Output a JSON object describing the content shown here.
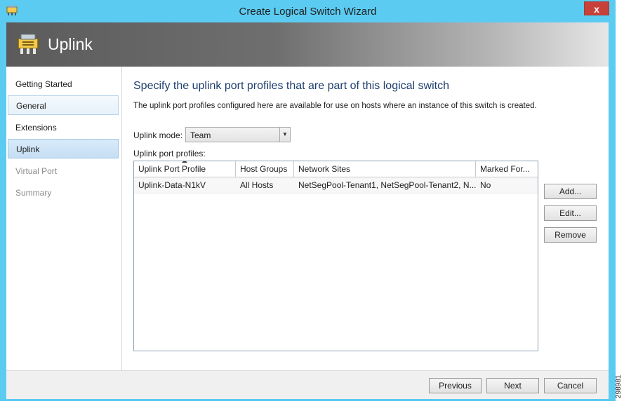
{
  "window": {
    "title": "Create Logical Switch Wizard",
    "close_label": "x",
    "icon": "logical-switch-icon"
  },
  "banner": {
    "title": "Uplink",
    "icon": "logical-switch-icon"
  },
  "nav": {
    "items": [
      {
        "label": "Getting Started",
        "state": "normal"
      },
      {
        "label": "General",
        "state": "completed"
      },
      {
        "label": "Extensions",
        "state": "normal"
      },
      {
        "label": "Uplink",
        "state": "selected"
      },
      {
        "label": "Virtual Port",
        "state": "disabled"
      },
      {
        "label": "Summary",
        "state": "disabled"
      }
    ]
  },
  "main": {
    "heading": "Specify the uplink port profiles that are part of this logical switch",
    "description": "The uplink port profiles configured here are available for use on hosts where an instance of this switch is created.",
    "uplink_mode_label": "Uplink mode:",
    "uplink_mode_value": "Team",
    "profiles_label": "Uplink port profiles:",
    "table": {
      "columns": [
        "Uplink Port Profile",
        "Host Groups",
        "Network Sites",
        "Marked For..."
      ],
      "rows": [
        [
          "Uplink-Data-N1kV",
          "All Hosts",
          "NetSegPool-Tenant1, NetSegPool-Tenant2, N...",
          "No"
        ]
      ]
    },
    "buttons": {
      "add": "Add...",
      "edit": "Edit...",
      "remove": "Remove"
    }
  },
  "footer": {
    "previous": "Previous",
    "next": "Next",
    "cancel": "Cancel"
  },
  "figure_id": "298981",
  "colors": {
    "frame": "#5ccbf1",
    "close": "#c7413a",
    "heading": "#1e3f6e",
    "selected_nav": "#c5def4"
  }
}
